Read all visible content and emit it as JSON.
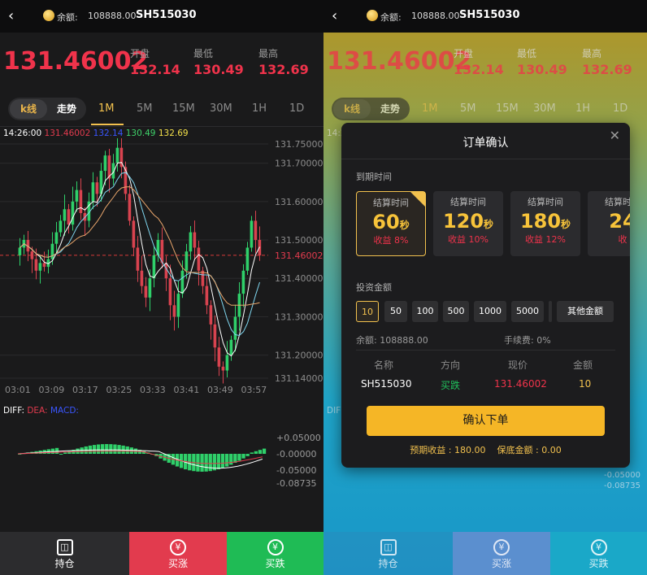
{
  "header": {
    "back_icon": "chevron-left-icon",
    "balance_label": "余额:",
    "balance_value": "108888.00",
    "symbol": "SH515030"
  },
  "quote": {
    "price": "131.46002",
    "open_label": "开盘",
    "open": "132.14",
    "low_label": "最低",
    "low": "130.49",
    "high_label": "最高",
    "high": "132.69"
  },
  "tabs": {
    "kline": "k线",
    "trend": "走势",
    "timeframes": [
      "1M",
      "5M",
      "15M",
      "30M",
      "1H",
      "1D"
    ],
    "active": "1M"
  },
  "legend": {
    "time": "14:26:00",
    "v1": "131.46002",
    "v2": "132.14",
    "v3": "130.49",
    "v4": "132.69"
  },
  "axis": {
    "price_ticks": [
      "131.75000",
      "131.70000",
      "131.60000",
      "131.50000",
      "131.46002",
      "131.40000",
      "131.30000",
      "131.20000",
      "131.14000"
    ],
    "time_ticks": [
      "03:01",
      "03:09",
      "03:17",
      "03:25",
      "03:33",
      "03:41",
      "03:49",
      "03:57"
    ]
  },
  "macd": {
    "diff_label": "DIFF:",
    "dea_label": "DEA:",
    "macd_label": "MACD:",
    "ticks": [
      "+0.05000",
      "-0.00000",
      "-0.05000",
      "-0.08735"
    ]
  },
  "footer": {
    "hold": "持仓",
    "buy_up": "买涨",
    "buy_down": "买跌",
    "hold_icon": "coins-icon",
    "up_icon": "yuan-icon",
    "down_icon": "yuan-icon"
  },
  "colors": {
    "up": "#e23b4e",
    "down": "#20c05c",
    "accent": "#f5b626",
    "ma1": "#ffffff",
    "ma2": "#7fd6ef",
    "ma3": "#e8a56b"
  },
  "modal": {
    "title": "订单确认",
    "expiry_label": "到期时间",
    "cards": [
      {
        "label": "结算时间",
        "num": "60",
        "unit": "秒",
        "profit": "收益 8%"
      },
      {
        "label": "结算时间",
        "num": "120",
        "unit": "秒",
        "profit": "收益 10%"
      },
      {
        "label": "结算时间",
        "num": "180",
        "unit": "秒",
        "profit": "收益 12%"
      },
      {
        "label": "结算时间",
        "num": "24",
        "unit": "",
        "profit": "收"
      }
    ],
    "amount_label": "投资金额",
    "amounts": [
      "10",
      "50",
      "100",
      "500",
      "1000",
      "5000"
    ],
    "other_amount": "其他金额",
    "balance_text": "余额: 108888.00",
    "fee_text": "手续费: 0%",
    "cols": [
      "名称",
      "方向",
      "现价",
      "金额"
    ],
    "row": {
      "name": "SH515030",
      "direction": "买跌",
      "price": "131.46002",
      "amount": "10"
    },
    "confirm": "确认下单",
    "estimate": "预期收益 : 180.00",
    "deposit": "保底金额 : 0.00"
  }
}
